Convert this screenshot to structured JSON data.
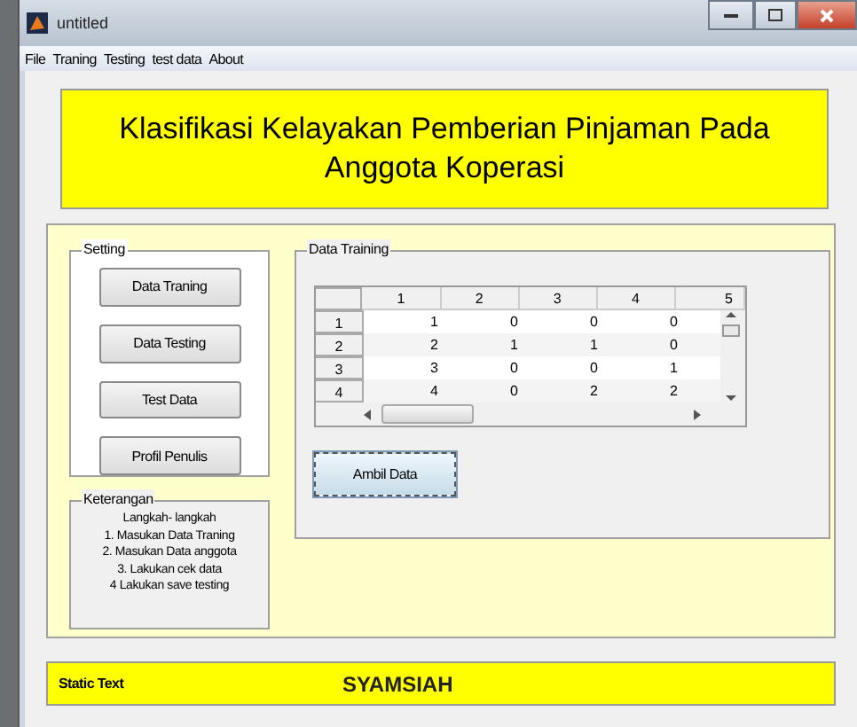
{
  "window": {
    "title": "untitled"
  },
  "menu": [
    "File",
    "Traning",
    "Testing",
    "test data",
    "About"
  ],
  "header": {
    "title": "Klasifikasi Kelayakan Pemberian Pinjaman Pada Anggota Koperasi"
  },
  "setting": {
    "title": "Setting",
    "buttons": [
      "Data Traning",
      "Data Testing",
      "Test Data",
      "Profil Penulis"
    ]
  },
  "keterangan": {
    "title": "Keterangan",
    "lines": [
      "Langkah- langkah",
      "1. Masukan Data Traning",
      "2. Masukan Data anggota",
      "3. Lakukan cek data",
      "4  Lakukan save testing"
    ]
  },
  "data_training": {
    "title": "Data Training",
    "table": {
      "columns": [
        "1",
        "2",
        "3",
        "4",
        "5"
      ],
      "rows": [
        {
          "header": "1",
          "cells": [
            "1",
            "0",
            "0",
            "0"
          ]
        },
        {
          "header": "2",
          "cells": [
            "2",
            "1",
            "1",
            "0"
          ]
        },
        {
          "header": "3",
          "cells": [
            "3",
            "0",
            "0",
            "1"
          ]
        },
        {
          "header": "4",
          "cells": [
            "4",
            "0",
            "2",
            "2"
          ]
        }
      ]
    },
    "button": "Ambil Data"
  },
  "footer": {
    "label": "Static Text",
    "name": "SYAMSIAH"
  }
}
